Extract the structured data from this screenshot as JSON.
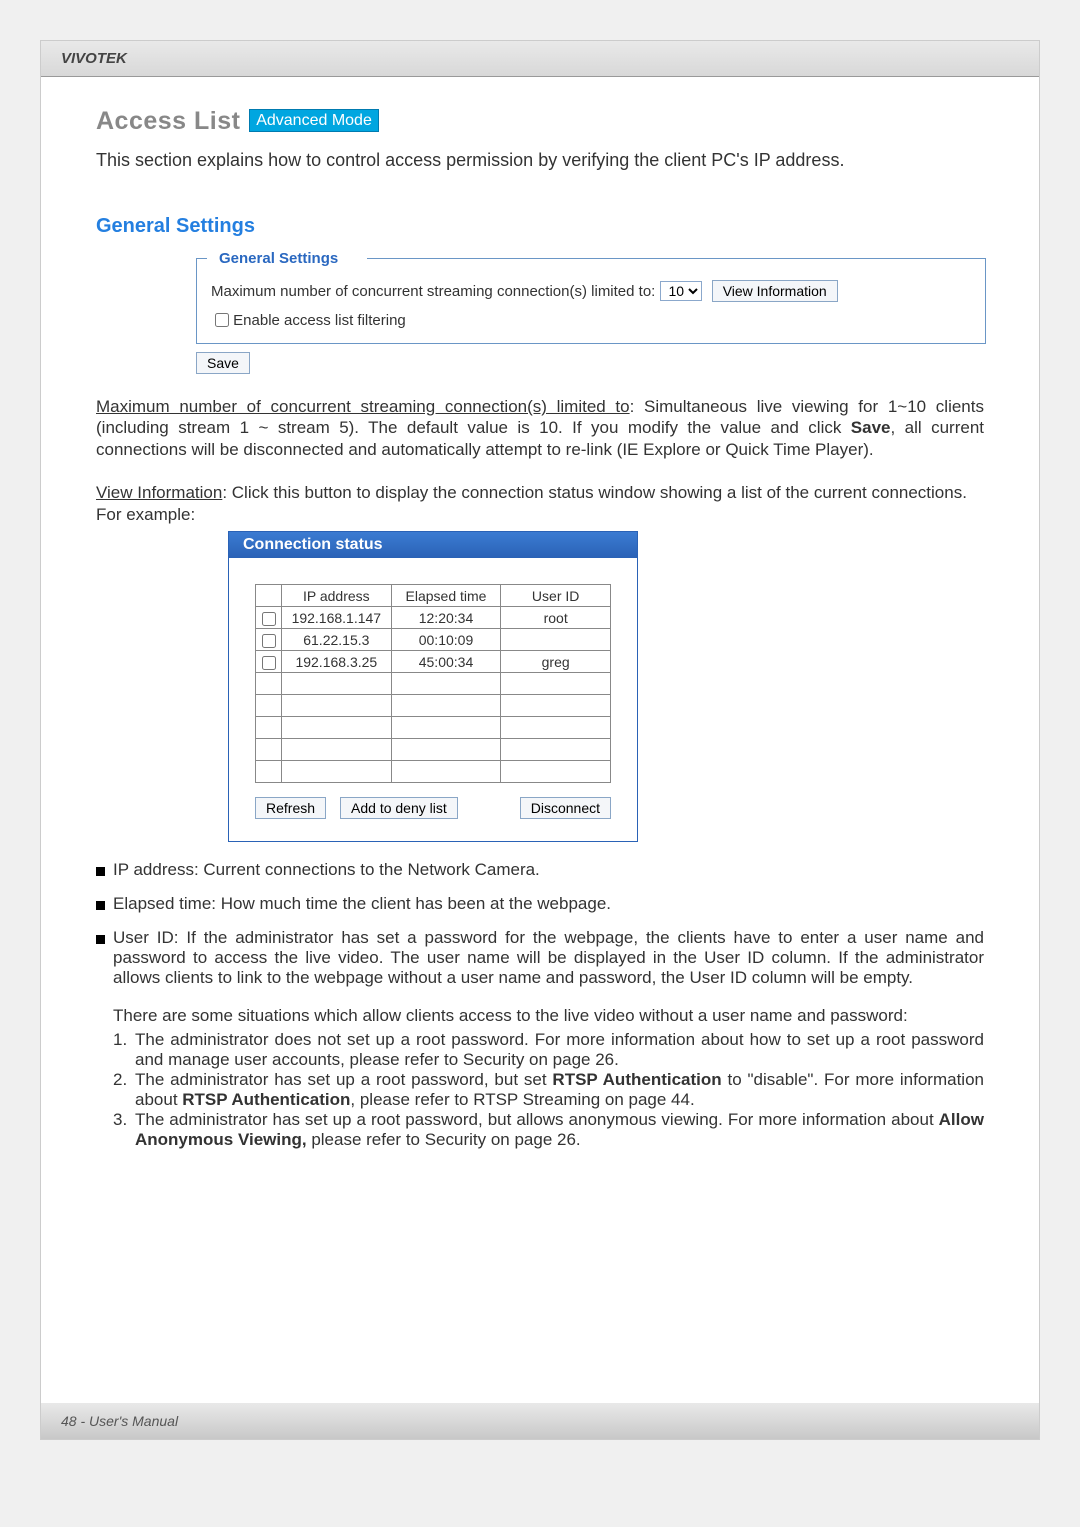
{
  "brand": "VIVOTEK",
  "footer": "48 - User's Manual",
  "heading": "Access List",
  "mode_badge": "Advanced Mode",
  "intro": "This section explains how to control access permission by verifying the client PC's IP address.",
  "section_general_title": "General Settings",
  "fieldset": {
    "legend": "General Settings",
    "max_label": "Maximum number of concurrent streaming connection(s) limited to:",
    "max_value": "10",
    "view_info_btn": "View Information",
    "enable_filter_label": "Enable access list filtering",
    "enable_filter_checked": false
  },
  "save_btn": "Save",
  "para_max": {
    "lead": "Maximum number of concurrent streaming connection(s) limited to",
    "rest_before": ": Simultaneous live viewing for 1~10 clients (including stream 1 ~ stream 5). The default value is 10. If you modify the value and click ",
    "save_word": "Save",
    "rest_after": ", all current connections will be disconnected and automatically attempt to re-link (IE Explore or Quick Time Player)."
  },
  "para_view": {
    "lead": "View Information",
    "rest": ": Click this button to display the connection status window showing a list of the current connections."
  },
  "for_example": "For example:",
  "conn": {
    "title": "Connection status",
    "headers": [
      "IP address",
      "Elapsed time",
      "User ID"
    ],
    "rows": [
      {
        "ip": "192.168.1.147",
        "time": "12:20:34",
        "user": "root"
      },
      {
        "ip": "61.22.15.3",
        "time": "00:10:09",
        "user": ""
      },
      {
        "ip": "192.168.3.25",
        "time": "45:00:34",
        "user": "greg"
      },
      {
        "ip": "",
        "time": "",
        "user": ""
      },
      {
        "ip": "",
        "time": "",
        "user": ""
      },
      {
        "ip": "",
        "time": "",
        "user": ""
      },
      {
        "ip": "",
        "time": "",
        "user": ""
      },
      {
        "ip": "",
        "time": "",
        "user": ""
      }
    ],
    "btn_refresh": "Refresh",
    "btn_deny": "Add to deny list",
    "btn_disconnect": "Disconnect"
  },
  "bullets": {
    "ip": "IP address: Current connections to the Network Camera.",
    "elapsed": "Elapsed time: How much time the client has been at the webpage.",
    "user": "User ID: If the administrator has set a password for the webpage, the clients have to enter a user name and password to access the live video. The user name will be displayed in the User ID column. If  the administrator allows clients to link to the webpage without a user name and password, the User ID column will be empty."
  },
  "situations_intro": "There are some situations which allow clients access to the live video without a user name and password:",
  "situations": [
    {
      "n": "1.",
      "t1": "The administrator does not set up a root password. For more information about how to set up a root password and manage user accounts, please refer to Security on page 26."
    },
    {
      "n": "2.",
      "t_before": "The administrator has set up a root password, but set ",
      "b1": "RTSP Authentication",
      "t_mid": " to \"disable\". For more information about ",
      "b2": "RTSP Authentication",
      "t_after": ", please refer to RTSP Streaming on page 44."
    },
    {
      "n": "3.",
      "t_before": "The administrator has set up a root password, but allows anonymous viewing. For more information about ",
      "b1": "Allow Anonymous Viewing,",
      "t_after": " please refer to Security on page 26."
    }
  ]
}
